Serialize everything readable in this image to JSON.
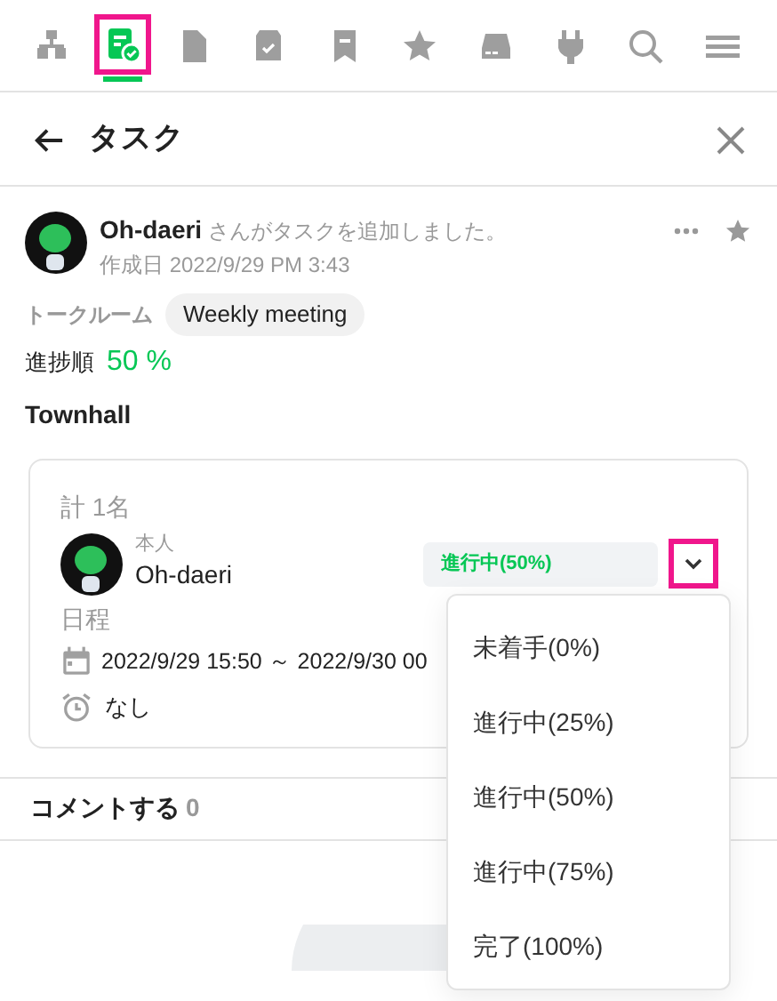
{
  "toolbar": {
    "items": [
      {
        "selected": false,
        "highlighted": false
      },
      {
        "selected": true,
        "highlighted": true
      },
      {
        "selected": false,
        "highlighted": false
      },
      {
        "selected": false,
        "highlighted": false
      },
      {
        "selected": false,
        "highlighted": false
      },
      {
        "selected": false,
        "highlighted": false
      },
      {
        "selected": false,
        "highlighted": false
      },
      {
        "selected": false,
        "highlighted": false
      },
      {
        "selected": false,
        "highlighted": false
      },
      {
        "selected": false,
        "highlighted": false
      }
    ]
  },
  "header": {
    "title": "タスク"
  },
  "post": {
    "author": "Oh-daeri",
    "action": "さんがタスクを追加しました。",
    "created": "作成日 2022/9/29 PM 3:43",
    "starred": false
  },
  "talk_room": {
    "label": "トークルーム",
    "value": "Weekly meeting"
  },
  "progress": {
    "label": "進捗順",
    "value": "50 %"
  },
  "task_title": "Townhall",
  "assignees": {
    "total": "計 1名",
    "people": [
      {
        "role": "本人",
        "name": "Oh-daeri",
        "status": "進行中(50%)",
        "toggle_highlighted": true
      }
    ]
  },
  "schedule": {
    "label": "日程",
    "range": "2022/9/29 15:50 ～ 2022/9/30 00",
    "reminder": "なし"
  },
  "status_menu": {
    "options": [
      "未着手(0%)",
      "進行中(25%)",
      "進行中(50%)",
      "進行中(75%)",
      "完了(100%)"
    ]
  },
  "comments": {
    "label": "コメントする",
    "count": "0"
  }
}
